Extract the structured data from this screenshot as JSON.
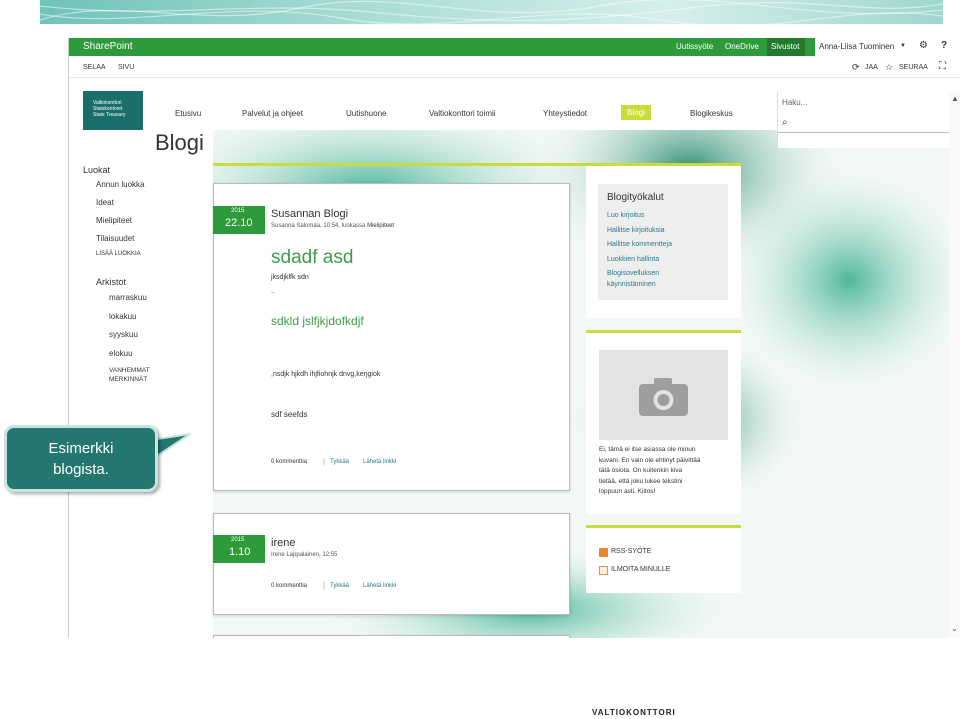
{
  "suitebar": {
    "brand": "SharePoint",
    "links": [
      "Uutissyöte",
      "OneDrive",
      "Sivustot"
    ],
    "user": "Anna-Liisa Tuominen"
  },
  "ribbon": {
    "tabs": [
      "SELAA",
      "SIVU"
    ],
    "share": "JAA",
    "follow": "SEURAA"
  },
  "logo": {
    "lines": [
      "Valtiokonttori",
      "Statskontoret",
      "State Treasury"
    ]
  },
  "topnav": [
    "Etusivu",
    "Palvelut ja ohjeet",
    "Uutishuone",
    "Valtiokonttori toimii",
    "Yhteystiedot",
    "Blogi",
    "Blogikeskus"
  ],
  "search": {
    "placeholder": "Haku..."
  },
  "page_title": "Blogi",
  "leftnav": {
    "categories_heading": "Luokat",
    "categories": [
      "Annun luokka",
      "Ideat",
      "Mielipiteet",
      "Tilaisuudet"
    ],
    "more_categories": "LISÄÄ LUOKKIA",
    "archive_heading": "Arkistot",
    "archive": [
      "marraskuu",
      "lokakuu",
      "syyskuu",
      "elokuu"
    ],
    "older": [
      "VANHEMMAT",
      "MERKINNÄT"
    ]
  },
  "posts": [
    {
      "year": "2015",
      "day": "22.10",
      "title": "Susannan Blogi",
      "author_time": "Susanna Salomaa, 10:54, luokassa ",
      "category": "Mielipiteet",
      "h1": "sdadf asd",
      "p1": "jksdjklfk sdn",
      "p2": "..",
      "h2": "sdkld jslfjkjdofkdjf",
      "p3": ",nsdjk hjkdh ihjfiohnjk dnvg,kerjgiok",
      "p4": "sdf seefds",
      "comments": "0 kommenttia",
      "like": "Tykkää",
      "send": "Lähetä linkki"
    },
    {
      "year": "2015",
      "day": "1.10",
      "title": "irene",
      "author_time": "Irene Lappalainen, 12:55",
      "comments": "0 kommenttia",
      "like": "Tykkää",
      "send": "Lähetä linkki"
    }
  ],
  "tools": {
    "heading": "Blogityökalut",
    "items": [
      "Luo kirjoitus",
      "Hallitse kirjoituksia",
      "Hallitse kommentteja",
      "Luokkien hallinta",
      "Blogisovelluksen",
      "käynnistäminen"
    ]
  },
  "about": {
    "lines": [
      "Ei, tämä ei itse asiassa ole minun",
      "kuvani. En vain ole ehtinyt päivittää",
      "tätä osiota. On kuitenkin kiva",
      "tietää, että joku lukee tekstini",
      "loppuun asti. Kiitos!"
    ]
  },
  "feeds": {
    "rss": "RSS-SYÖTE",
    "notify": "ILMOITA MINULLE"
  },
  "callout": {
    "line1": "Esimerkki",
    "line2": "blogista."
  },
  "footer": "VALTIOKONTTORI",
  "colors": {
    "suitebar": "#2f9a3c",
    "accent": "#c9dd3a",
    "logo": "#1b6f6a",
    "callout": "#24776f"
  }
}
